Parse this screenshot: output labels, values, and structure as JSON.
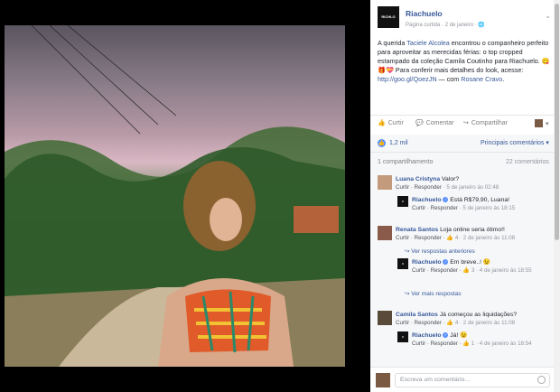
{
  "photo": {
    "alt": ""
  },
  "post": {
    "logo_text": "RICHLO",
    "page_name": "Riachuelo",
    "meta": "Página curtida · 2 de janeiro ·",
    "text_1": "A querida ",
    "mention_1": "Taciele Alcolea",
    "text_2": " encontrou o companheiro perfeito para aproveitar as merecidas férias: o top cropped estampado da coleção Camila Coutinho para Riachuelo. 😋🎁💝 Para conferir mais detalhes do look, acesse: ",
    "link": "http://goo.gl/QoezJN",
    "text_3": " — com ",
    "mention_2": "Rosane Cravo",
    "text_4": "."
  },
  "actions": {
    "like": "Curtir",
    "comment": "Comentar",
    "share": "Compartilhar"
  },
  "reactions": {
    "likes": "1,2 mil",
    "sort": "Principais comentários ▾",
    "shares": "1 compartilhamento",
    "comments_count": "22 comentários"
  },
  "comments": [
    {
      "who": "Luana Cristyna",
      "text": " Valor?",
      "meta_actions": "Curtir · Responder",
      "meta_date": " · 5 de janeiro às 02:48"
    },
    {
      "who": "Riachuelo",
      "text": " Está R$79,90, Luana!",
      "meta_actions": "Curtir · Responder",
      "meta_date": " · 5 de janeiro às 18:15"
    },
    {
      "who": "Renata Santos",
      "text": " Loja online seria ótimo!!",
      "meta_actions": "Curtir · Responder · ",
      "meta_likes": "👍 4",
      "meta_date": " · 2 de janeiro às 11:08"
    },
    {
      "reply_link": "↪ Ver respostas anteriores"
    },
    {
      "who": "Riachuelo",
      "text": " Em breve..! 😉",
      "meta_actions": "Curtir · Responder · ",
      "meta_likes": "👍 3",
      "meta_date": " · 4 de janeiro às 18:55"
    },
    {
      "reply_link": "↪ Ver mais respostas"
    },
    {
      "who": "Camila Santos",
      "text": " Já começou as liquidações?",
      "meta_actions": "Curtir · Responder · ",
      "meta_likes": "👍 4",
      "meta_date": " · 2 de janeiro às 11:08"
    },
    {
      "who": "Riachuelo",
      "text": " Já! 😉",
      "meta_actions": "Curtir · Responder · ",
      "meta_likes": "👍 1",
      "meta_date": " · 4 de janeiro às 18:54"
    }
  ],
  "write": {
    "placeholder": "Escreva um comentário..."
  }
}
